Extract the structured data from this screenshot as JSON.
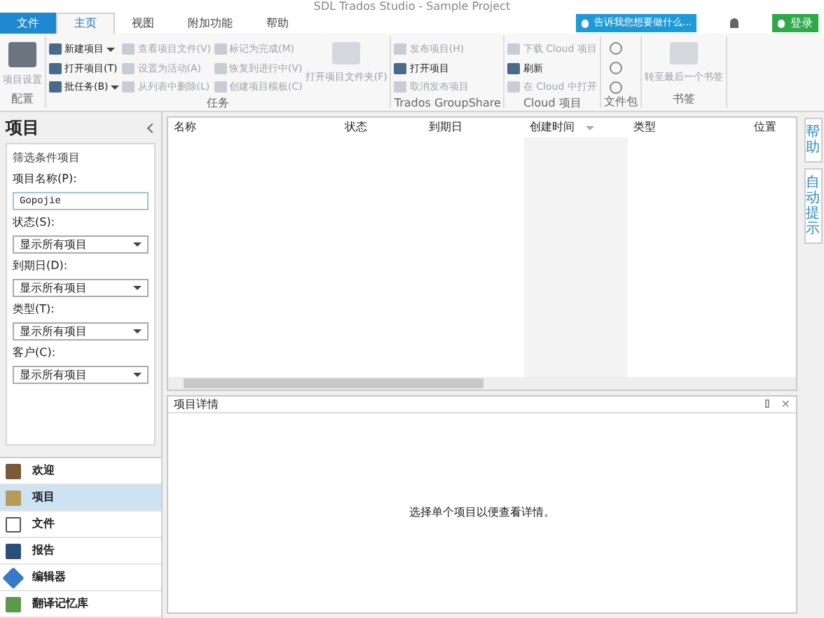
{
  "window": {
    "title": "SDL Trados Studio - Sample Project"
  },
  "menu_tabs": [
    {
      "label": "文件",
      "kind": "file"
    },
    {
      "label": "主页",
      "kind": "tab",
      "selected": true
    },
    {
      "label": "视图",
      "kind": "tab",
      "selected": false
    },
    {
      "label": "附加功能",
      "kind": "tab",
      "selected": false
    },
    {
      "label": "帮助",
      "kind": "tab",
      "selected": false
    }
  ],
  "tell_me": {
    "placeholder": "告诉我您想要做什么..."
  },
  "sign_in": {
    "label": "登录"
  },
  "ribbon_groups": [
    {
      "title": "配置",
      "kind": "standard",
      "large": [
        {
          "label": "项目设置",
          "disabled": true
        }
      ]
    },
    {
      "title": "任务",
      "kind": "standard",
      "items": [
        {
          "label": "新建项目",
          "disabled": false,
          "dropdown": true
        },
        {
          "label": "打开项目(T)",
          "disabled": false,
          "dropdown": false
        },
        {
          "label": "批任务(B)",
          "disabled": false,
          "dropdown": true
        },
        {
          "label": "查看项目文件(V)",
          "disabled": true,
          "dropdown": false
        },
        {
          "label": "设置为活动(A)",
          "disabled": true,
          "dropdown": false
        },
        {
          "label": "从列表中删除(L)",
          "disabled": true,
          "dropdown": false
        },
        {
          "label": "标记为完成(M)",
          "disabled": true,
          "dropdown": false
        },
        {
          "label": "恢复到进行中(V)",
          "disabled": true,
          "dropdown": false
        },
        {
          "label": "创建项目模板(C)",
          "disabled": true,
          "dropdown": false
        }
      ],
      "large": [
        {
          "label": "打开项目文件夹(F)",
          "disabled": true
        }
      ]
    },
    {
      "title": "Trados GroupShare",
      "kind": "standard",
      "items": [
        {
          "label": "发布项目(H)",
          "disabled": true,
          "dropdown": false
        },
        {
          "label": "打开项目",
          "disabled": false,
          "dropdown": false
        },
        {
          "label": "取消发布项目",
          "disabled": true,
          "dropdown": false
        }
      ]
    },
    {
      "title": "Cloud 项目",
      "kind": "standard",
      "items": [
        {
          "label": "下载 Cloud 项目",
          "disabled": true,
          "dropdown": false
        },
        {
          "label": "刷新",
          "disabled": false,
          "dropdown": false
        },
        {
          "label": "在 Cloud 中打开",
          "disabled": true,
          "dropdown": false
        }
      ]
    },
    {
      "title": "文件包",
      "kind": "icons"
    },
    {
      "title": "书签",
      "kind": "standard",
      "large": [
        {
          "label": "转至最后一个书签",
          "disabled": true
        }
      ]
    }
  ],
  "close_glyph": "✕",
  "filter_panel": {
    "title": "项目",
    "group_title": "筛选条件项目",
    "name_label": "项目名称(P):",
    "name_value": "Gopojie",
    "selects": [
      {
        "label": "状态(S):",
        "value": "显示所有项目"
      },
      {
        "label": "到期日(D):",
        "value": "显示所有项目"
      },
      {
        "label": "类型(T):",
        "value": "显示所有项目"
      },
      {
        "label": "客户(C):",
        "value": "显示所有项目"
      }
    ]
  },
  "nav_items": [
    {
      "label": "欢迎",
      "kind": "home",
      "selected": false
    },
    {
      "label": "项目",
      "kind": "projects",
      "selected": true
    },
    {
      "label": "文件",
      "kind": "files",
      "selected": false
    },
    {
      "label": "报告",
      "kind": "reports",
      "selected": false
    },
    {
      "label": "编辑器",
      "kind": "editor",
      "selected": false
    },
    {
      "label": "翻译记忆库",
      "kind": "tm",
      "selected": false
    }
  ],
  "table": {
    "columns": [
      {
        "label": "名称",
        "sorted": false
      },
      {
        "label": "状态",
        "sorted": false
      },
      {
        "label": "到期日",
        "sorted": false
      },
      {
        "label": "创建时间",
        "sorted": true
      },
      {
        "label": "类型",
        "sorted": false
      },
      {
        "label": "位置",
        "sorted": false
      }
    ]
  },
  "details": {
    "title": "项目详情",
    "message": "选择单个项目以便查看详情。"
  },
  "side_tabs": [
    {
      "label": "帮助"
    },
    {
      "label": "自动提示"
    }
  ]
}
